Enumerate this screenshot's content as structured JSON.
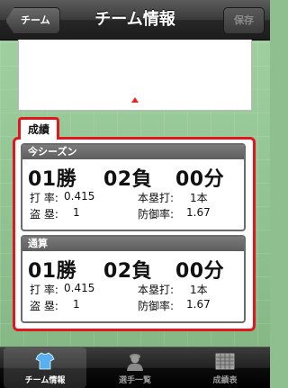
{
  "nav": {
    "back_label": "チーム",
    "title": "チーム情報",
    "save_label": "保存"
  },
  "section": {
    "title": "成績"
  },
  "season": {
    "header": "今シーズン",
    "wins": "01勝",
    "losses": "02負",
    "draws": "00分",
    "batting_avg_label": "打 率:",
    "batting_avg": "0.415",
    "hr_label": "本塁打:",
    "hr": "1本",
    "steals_label": "盗 塁:",
    "steals": "1",
    "era_label": "防御率:",
    "era": "1.67"
  },
  "career": {
    "header": "通算",
    "wins": "01勝",
    "losses": "02負",
    "draws": "00分",
    "batting_avg_label": "打 率:",
    "batting_avg": "0.415",
    "hr_label": "本塁打:",
    "hr": "1本",
    "steals_label": "盗 塁:",
    "steals": "1",
    "era_label": "防御率:",
    "era": "1.67"
  },
  "tabs": [
    {
      "label": "チーム情報",
      "icon": "shirt-icon",
      "active": true
    },
    {
      "label": "選手一覧",
      "icon": "player-icon",
      "active": false
    },
    {
      "label": "成績表",
      "icon": "table-icon",
      "active": false
    }
  ],
  "colors": {
    "accent_red": "#e3171b",
    "nav_dark": "#1c1c1c",
    "field_green": "#8fbf8f"
  }
}
